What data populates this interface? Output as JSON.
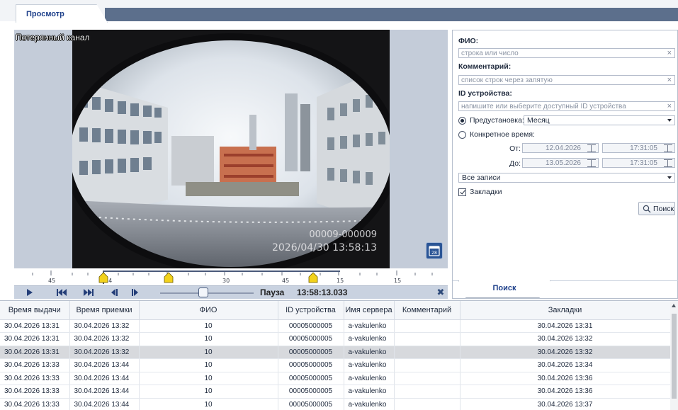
{
  "tabs": [
    {
      "label": "Просмотр",
      "active": true
    }
  ],
  "video": {
    "lost_channel_label": "Потерянный канал",
    "osd_counter": "00009-000009",
    "osd_datetime": "2026/04/30 13:58:13",
    "calendar_day": "28"
  },
  "timeline": {
    "labels": [
      "45",
      "14",
      "30",
      "45",
      "15",
      "15"
    ],
    "markers": 4
  },
  "transport": {
    "state_label": "Пауза",
    "time": "13:58:13.033"
  },
  "filters": {
    "fio_label": "ФИО:",
    "fio_placeholder": "строка или число",
    "comment_label": "Комментарий:",
    "comment_placeholder": "список строк через запятую",
    "device_label": "ID устройства:",
    "device_placeholder": "напишите или выберите доступный ID устройства",
    "preset_label": "Предустановка:",
    "preset_value": "Месяц",
    "specific_time_label": "Конкретное время:",
    "from_label": "От:",
    "from_date": "12.04.2026",
    "from_time": "17:31:05",
    "to_label": "До:",
    "to_date": "13.05.2026",
    "to_time": "17:31:05",
    "records_value": "Все записи",
    "bookmarks_label": "Закладки",
    "search_button": "Поиск",
    "bottom_tab": "Поиск"
  },
  "table": {
    "headers": [
      "Время выдачи",
      "Время приемки",
      "ФИО",
      "ID устройства",
      "Имя сервера",
      "Комментарий",
      "Закладки"
    ],
    "rows": [
      [
        "30.04.2026 13:31",
        "30.04.2026 13:32",
        "10",
        "00005000005",
        "a-vakulenko",
        "",
        "30.04.2026 13:31"
      ],
      [
        "30.04.2026 13:31",
        "30.04.2026 13:32",
        "10",
        "00005000005",
        "a-vakulenko",
        "",
        "30.04.2026 13:32"
      ],
      [
        "30.04.2026 13:31",
        "30.04.2026 13:32",
        "10",
        "00005000005",
        "a-vakulenko",
        "",
        "30.04.2026 13:32"
      ],
      [
        "30.04.2026 13:33",
        "30.04.2026 13:44",
        "10",
        "00005000005",
        "a-vakulenko",
        "",
        "30.04.2026 13:34"
      ],
      [
        "30.04.2026 13:33",
        "30.04.2026 13:44",
        "10",
        "00005000005",
        "a-vakulenko",
        "",
        "30.04.2026 13:36"
      ],
      [
        "30.04.2026 13:33",
        "30.04.2026 13:44",
        "10",
        "00005000005",
        "a-vakulenko",
        "",
        "30.04.2026 13:36"
      ],
      [
        "30.04.2026 13:33",
        "30.04.2026 13:44",
        "10",
        "00005000005",
        "a-vakulenko",
        "",
        "30.04.2026 13:37"
      ]
    ],
    "selected_row": 2
  },
  "colors": {
    "accent": "#1d3f8a",
    "header_strip": "#5c6f8c",
    "marker": "#f2d21b"
  }
}
